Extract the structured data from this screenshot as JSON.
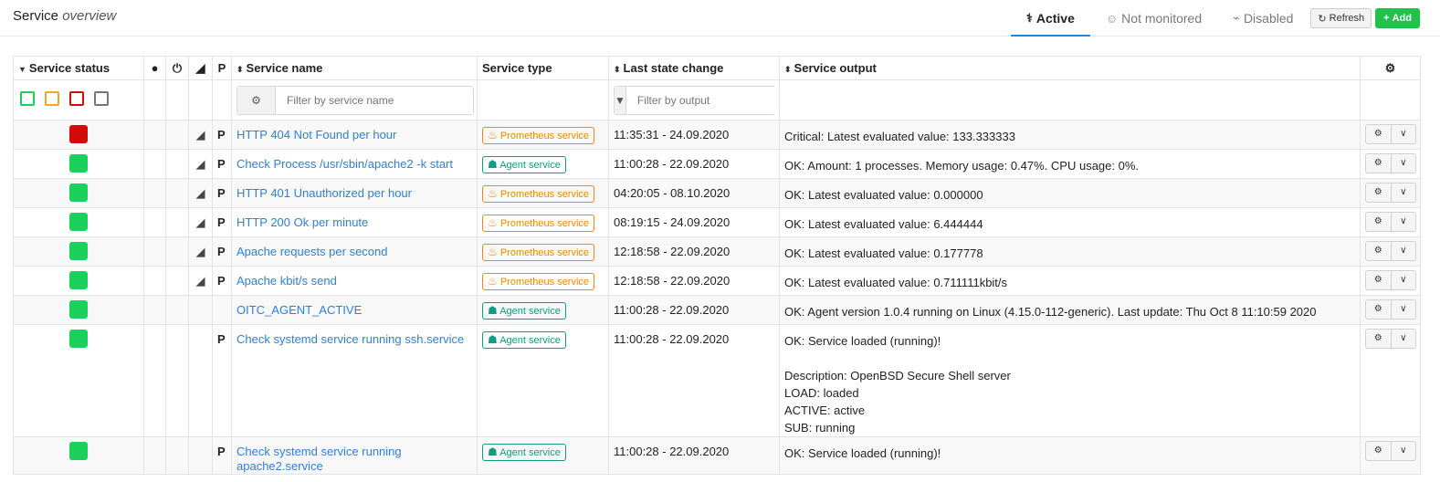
{
  "header": {
    "title_main": "Service",
    "title_sub": "overview",
    "tabs": [
      {
        "label": "Active",
        "icon": "stethoscope-icon"
      },
      {
        "label": "Not monitored",
        "icon": "user-md-icon"
      },
      {
        "label": "Disabled",
        "icon": "plug-icon"
      }
    ],
    "refresh_label": "Refresh",
    "add_label": "Add"
  },
  "table": {
    "columns": {
      "status": "Service status",
      "acknowledged": "user-icon",
      "downtime": "power-icon",
      "graph": "area-chart-icon",
      "passive": "P",
      "name": "Service name",
      "type": "Service type",
      "last_change": "Last state change",
      "output": "Service output",
      "settings": "gear-icon"
    },
    "filters": {
      "name_placeholder": "Filter by service name",
      "output_placeholder": "Filter by output",
      "status_colors": [
        "#1dd05c",
        "#f5a623",
        "#d20b0b",
        "#777777"
      ]
    },
    "rows": [
      {
        "status": "critical",
        "graph": true,
        "passive": "P",
        "name": "HTTP 404 Not Found per hour",
        "type": "Prometheus service",
        "type_kind": "prom",
        "last_change": "11:35:31 - 24.09.2020",
        "output": [
          "Critical: Latest evaluated value: 133.333333"
        ]
      },
      {
        "status": "ok",
        "graph": true,
        "passive": "P",
        "name": "Check Process /usr/sbin/apache2 -k start",
        "type": "Agent service",
        "type_kind": "agent",
        "last_change": "11:00:28 - 22.09.2020",
        "output": [
          "OK: Amount: 1 processes. Memory usage: 0.47%. CPU usage: 0%."
        ]
      },
      {
        "status": "ok",
        "graph": true,
        "passive": "P",
        "name": "HTTP 401 Unauthorized per hour",
        "type": "Prometheus service",
        "type_kind": "prom",
        "last_change": "04:20:05 - 08.10.2020",
        "output": [
          "OK: Latest evaluated value: 0.000000"
        ]
      },
      {
        "status": "ok",
        "graph": true,
        "passive": "P",
        "name": "HTTP 200 Ok per minute",
        "type": "Prometheus service",
        "type_kind": "prom",
        "last_change": "08:19:15 - 24.09.2020",
        "output": [
          "OK: Latest evaluated value: 6.444444"
        ]
      },
      {
        "status": "ok",
        "graph": true,
        "passive": "P",
        "name": "Apache requests per second",
        "type": "Prometheus service",
        "type_kind": "prom",
        "last_change": "12:18:58 - 22.09.2020",
        "output": [
          "OK: Latest evaluated value: 0.177778"
        ]
      },
      {
        "status": "ok",
        "graph": true,
        "passive": "P",
        "name": "Apache kbit/s send",
        "type": "Prometheus service",
        "type_kind": "prom",
        "last_change": "12:18:58 - 22.09.2020",
        "output": [
          "OK: Latest evaluated value: 0.711111kbit/s"
        ]
      },
      {
        "status": "ok",
        "graph": false,
        "passive": "",
        "name": "OITC_AGENT_ACTIVE",
        "type": "Agent service",
        "type_kind": "agent",
        "last_change": "11:00:28 - 22.09.2020",
        "output": [
          "OK: Agent version 1.0.4 running on Linux (4.15.0-112-generic). Last update: Thu Oct 8 11:10:59 2020"
        ]
      },
      {
        "status": "ok",
        "graph": false,
        "passive": "P",
        "name": "Check systemd service running ssh.service",
        "type": "Agent service",
        "type_kind": "agent",
        "last_change": "11:00:28 - 22.09.2020",
        "output": [
          "OK: Service loaded (running)!",
          "",
          "Description: OpenBSD Secure Shell server",
          "LOAD: loaded",
          "ACTIVE: active",
          "SUB: running"
        ]
      },
      {
        "status": "ok",
        "graph": false,
        "passive": "P",
        "name": "Check systemd service running apache2.service",
        "type": "Agent service",
        "type_kind": "agent",
        "last_change": "11:00:28 - 22.09.2020",
        "output": [
          "OK: Service loaded (running)!"
        ]
      }
    ]
  }
}
